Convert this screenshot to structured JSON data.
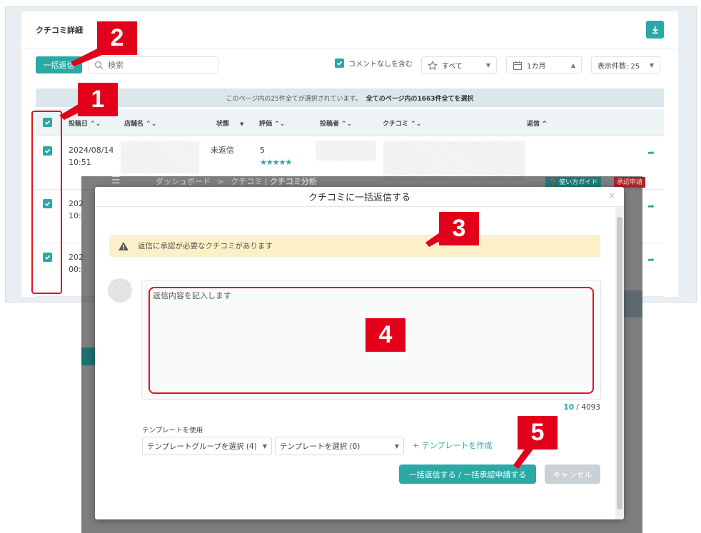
{
  "header": {
    "title": "クチコミ詳細",
    "download_icon": "download-icon"
  },
  "toolbar": {
    "bulk_reply_label": "一括返信",
    "search_placeholder": "検索",
    "no_comment_label": "コメントなしを含む",
    "rating_filter": "すべて",
    "period_filter": "1カ月",
    "page_size": "表示件数: 25"
  },
  "selection_banner": {
    "text": "このページ内の25件全てが選択されています。",
    "select_all_link": "全てのページ内の1663件全てを選択"
  },
  "table": {
    "columns": [
      "投稿日",
      "店舗名",
      "状態",
      "評価",
      "投稿者",
      "クチコミ",
      "返信"
    ],
    "rows": [
      {
        "date": "2024/08/14",
        "time": "10:51",
        "status": "未返信",
        "rating": "5",
        "stars": "★★★★★"
      },
      {
        "date": "202",
        "time": "10:",
        "status": "",
        "rating": "",
        "stars": ""
      },
      {
        "date": "202",
        "time": "00:",
        "status": "",
        "rating": "",
        "stars": ""
      }
    ]
  },
  "background_ghost": {
    "breadcrumb_home": "ダッシュボード",
    "breadcrumb_sep": ">",
    "breadcrumb_mid": "クチコミ",
    "breadcrumb_current": "クチコミ分析",
    "guide_button": "使い方ガイド",
    "approval_button": "承認申請"
  },
  "modal": {
    "title": "クチコミに一括返信する",
    "close_label": "×",
    "warning_text": "返信に承認が必要なクチコミがあります",
    "reply_value": "返信内容を記入します",
    "char_count": "10",
    "char_limit": "/ 4093",
    "template_label": "テンプレートを使用",
    "template_group_select": "テンプレートグループを選択 (4)",
    "template_select": "テンプレートを選択 (0)",
    "create_template": "+ テンプレートを作成",
    "submit_label": "一括返信する / 一括承認申請する",
    "cancel_label": "キャンセル"
  },
  "callouts": [
    "1",
    "2",
    "3",
    "4",
    "5"
  ],
  "colors": {
    "accent": "#2aa9a5",
    "callout": "#e3001b",
    "warning_bg": "#fcf0c8"
  }
}
